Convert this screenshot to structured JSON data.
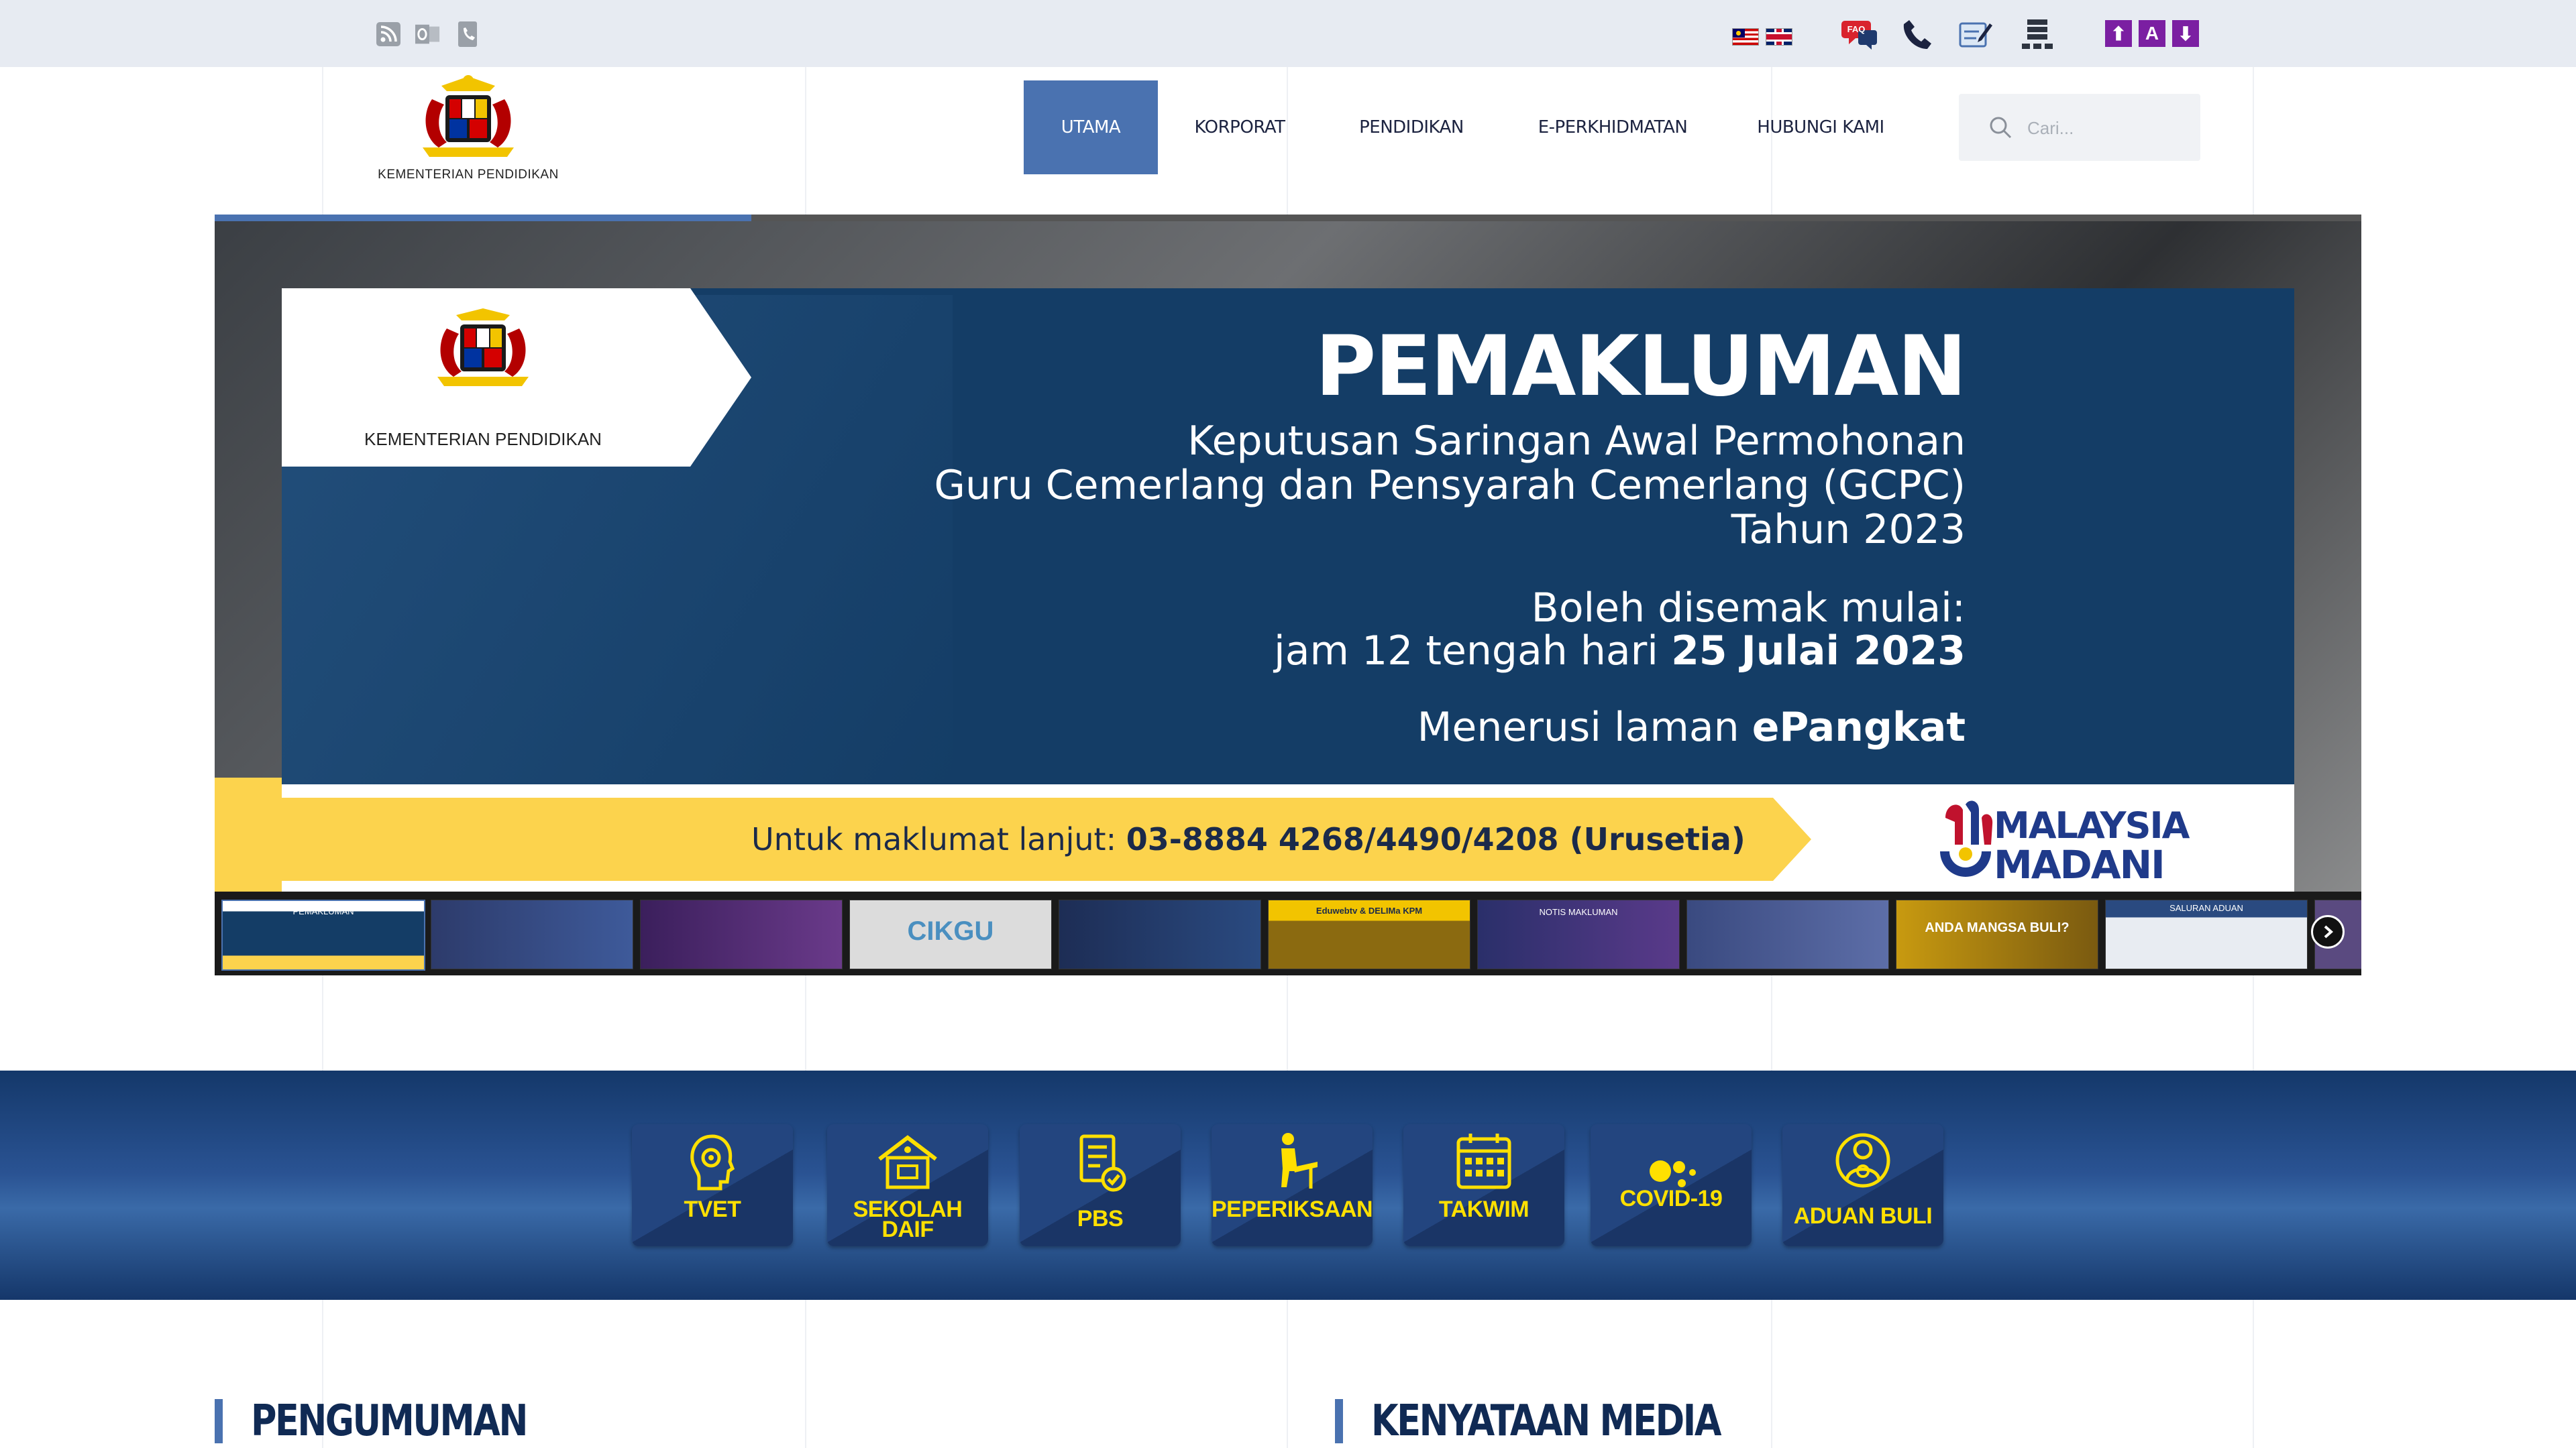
{
  "topbar": {
    "left_icons": [
      "rss-icon",
      "outlook-icon",
      "contact-card-icon"
    ],
    "languages": [
      "Bahasa Melayu",
      "English"
    ],
    "right_icons": [
      "faq-icon",
      "phone-icon",
      "feedback-icon",
      "sitemap-icon"
    ],
    "faq_label": "FAQ",
    "accessibility": [
      "⬆",
      "A",
      "⬇"
    ]
  },
  "header": {
    "logo_caption": "KEMENTERIAN PENDIDIKAN",
    "nav": [
      "UTAMA",
      "KORPORAT",
      "PENDIDIKAN",
      "E-PERKHIDMATAN",
      "HUBUNGI KAMI"
    ],
    "active_nav": "UTAMA",
    "search_placeholder": "Cari..."
  },
  "slider": {
    "logo_caption": "KEMENTERIAN PENDIDIKAN",
    "title": "PEMAKLUMAN",
    "subtitle_lines": [
      "Keputusan Saringan Awal Permohonan",
      "Guru Cemerlang dan Pensyarah Cemerlang (GCPC)",
      "Tahun 2023"
    ],
    "date_intro": "Boleh disemak mulai:",
    "date_prefix": "jam 12 tengah hari ",
    "date_bold": "25 Julai 2023",
    "via_prefix": "Menerusi laman ",
    "via_bold": "ePangkat",
    "info_prefix": "Untuk maklumat lanjut: ",
    "info_bold": "03-8884 4268/4490/4208 (Urusetia)",
    "brand_line1": "MALAYSIA",
    "brand_line2": "MADANI",
    "thumbnails": [
      "PEMAKLUMAN",
      "",
      "",
      "CIKGU",
      "",
      "Eduwebtv & DELIMa KPM",
      "NOTIS MAKLUMAN",
      "",
      "ANDA MANGSA BULI?",
      "SALURAN ADUAN"
    ],
    "progress_fraction": 0.25
  },
  "quick_links": [
    "TVET",
    "SEKOLAH DAIF",
    "PBS",
    "PEPERIKSAAN",
    "TAKWIM",
    "COVID-19",
    "ADUAN BULI"
  ],
  "sections": {
    "left_title": "PENGUMUMAN",
    "right_title": "KENYATAAN MEDIA"
  },
  "colors": {
    "accent": "#4a72b0",
    "quick_label": "#ffe000",
    "heading": "#102a54",
    "utility_bar": "#e7ebf2",
    "accessibility": "#7b1fa2"
  }
}
